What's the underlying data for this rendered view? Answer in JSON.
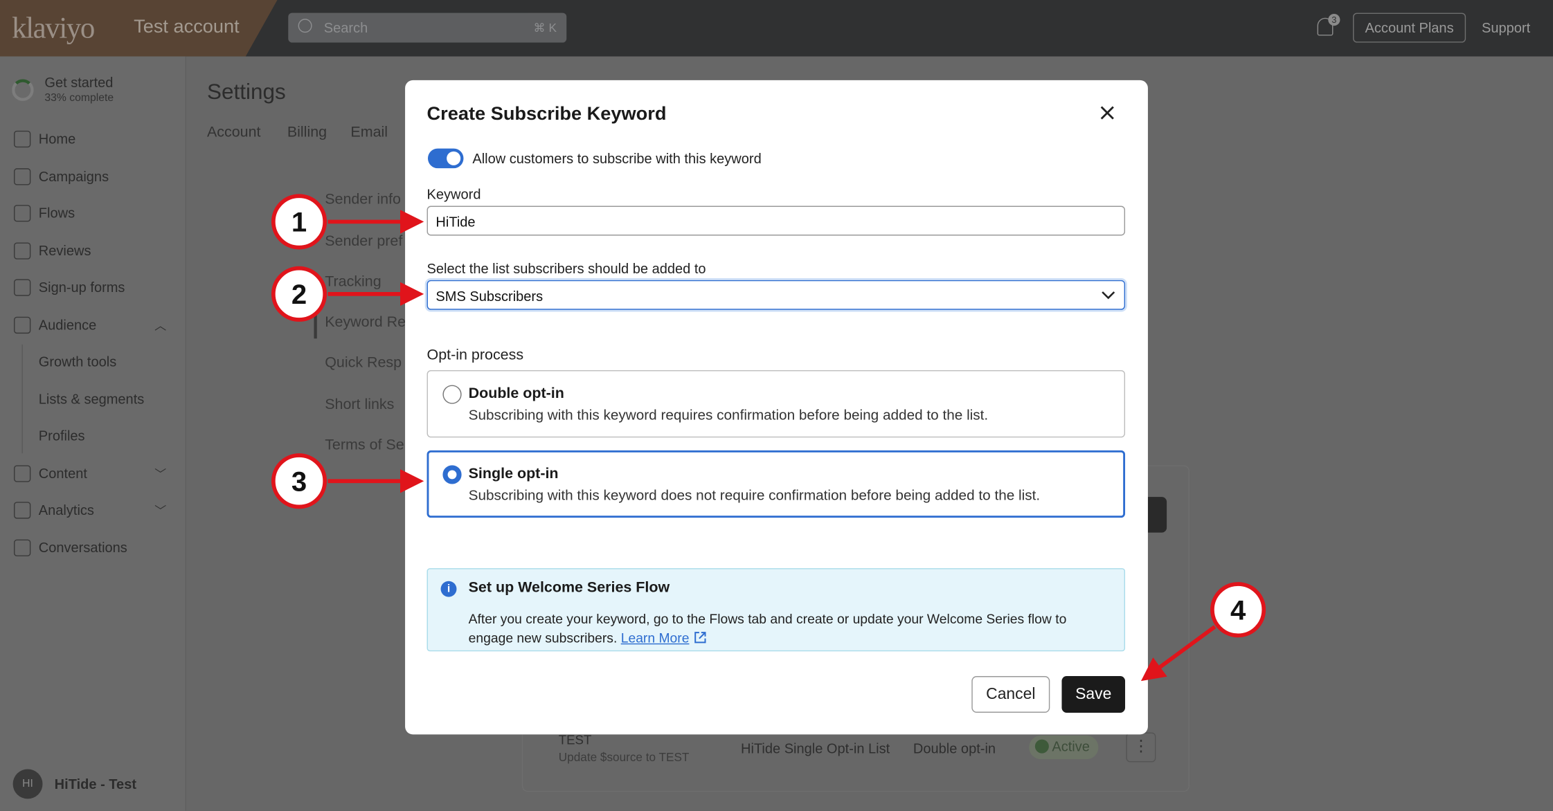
{
  "topbar": {
    "logo": "klaviyo",
    "account": "Test account",
    "search_placeholder": "Search",
    "search_shortcut": "⌘ K",
    "notifications_count": "3",
    "account_plans": "Account Plans",
    "support": "Support"
  },
  "sidebar": {
    "get_started": "Get started",
    "progress": "33% complete",
    "progress_value": 33,
    "items": [
      {
        "label": "Home",
        "icon": "home-icon"
      },
      {
        "label": "Campaigns",
        "icon": "send-icon"
      },
      {
        "label": "Flows",
        "icon": "flows-icon"
      },
      {
        "label": "Reviews",
        "icon": "star-icon"
      },
      {
        "label": "Sign-up forms",
        "icon": "form-icon"
      },
      {
        "label": "Audience",
        "icon": "audience-icon"
      },
      {
        "label": "Growth tools"
      },
      {
        "label": "Lists & segments"
      },
      {
        "label": "Profiles"
      },
      {
        "label": "Content",
        "icon": "content-icon"
      },
      {
        "label": "Analytics",
        "icon": "analytics-icon"
      },
      {
        "label": "Conversations",
        "icon": "chat-icon"
      }
    ],
    "user_initials": "HI",
    "user_name": "HiTide - Test"
  },
  "settings": {
    "title": "Settings",
    "tabs": [
      "Account",
      "Billing",
      "Email"
    ],
    "subnav": [
      "Sender info",
      "Sender pref",
      "Tracking",
      "Keyword Re",
      "Quick Resp",
      "Short links",
      "Terms of Se"
    ],
    "row": {
      "keyword": "TEST",
      "description": "Update $source to TEST",
      "list": "HiTide Single Opt-in List",
      "optin": "Double opt-in",
      "status": "Active"
    }
  },
  "modal": {
    "title": "Create Subscribe Keyword",
    "toggle_label": "Allow customers to subscribe with this keyword",
    "toggle_on": true,
    "keyword_label": "Keyword",
    "keyword_value": "HiTide",
    "list_label": "Select the list subscribers should be added to",
    "list_value": "SMS Subscribers",
    "optin_label": "Opt-in process",
    "options": [
      {
        "title": "Double opt-in",
        "desc": "Subscribing with this keyword requires confirmation before being added to the list.",
        "selected": false
      },
      {
        "title": "Single opt-in",
        "desc": "Subscribing with this keyword does not require confirmation before being added to the list.",
        "selected": true
      }
    ],
    "info_title": "Set up Welcome Series Flow",
    "info_text": "After you create your keyword, go to the Flows tab and create or update your Welcome Series flow to engage new subscribers.",
    "info_link": "Learn More",
    "cancel": "Cancel",
    "save": "Save"
  },
  "annotations": [
    "1",
    "2",
    "3",
    "4"
  ],
  "colors": {
    "accent": "#2e6dd0",
    "annotation": "#e0141b",
    "info_bg": "#e5f5fb"
  }
}
